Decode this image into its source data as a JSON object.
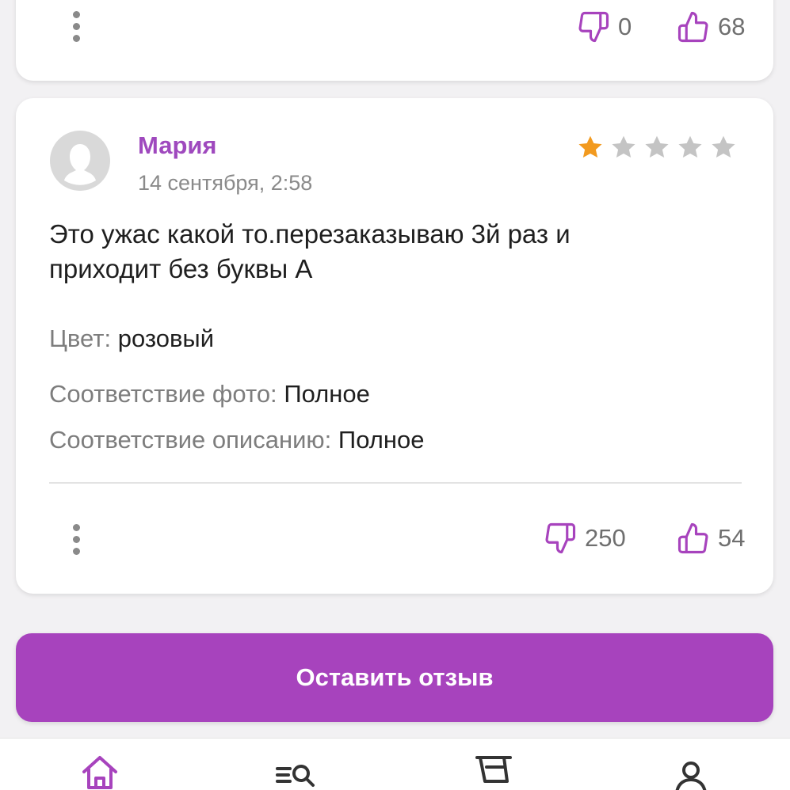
{
  "previous_review": {
    "dislikes": "0",
    "likes": "68"
  },
  "review": {
    "author": "Мария",
    "date": "14 сентября, 2:58",
    "rating": 1,
    "rating_max": 5,
    "text_line1": "Это ужас какой то.перезаказываю 3й раз и",
    "text_line2": "приходит без буквы А",
    "attributes": [
      {
        "label": "Цвет:",
        "value": "розовый"
      },
      {
        "label": "Соответствие фото:",
        "value": "Полное"
      },
      {
        "label": "Соответствие описанию:",
        "value": "Полное"
      }
    ],
    "dislikes": "250",
    "likes": "54"
  },
  "cta": {
    "label": "Оставить отзыв"
  },
  "colors": {
    "accent": "#a743bd",
    "author": "#9f49be",
    "star_active": "#f29a1f",
    "star_inactive": "#c4c4c4"
  },
  "icons": {
    "more": "more-vertical-icon",
    "dislike": "thumbs-down-icon",
    "like": "thumbs-up-icon",
    "tabs": [
      "home-icon",
      "catalog-search-icon",
      "cart-icon",
      "profile-icon"
    ]
  }
}
